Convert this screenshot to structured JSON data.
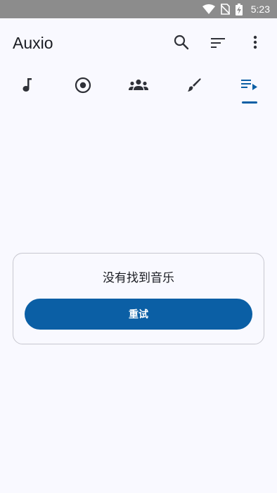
{
  "status_bar": {
    "time": "5:23",
    "icons": [
      "wifi-icon",
      "no-sim-icon",
      "battery-charging-icon"
    ]
  },
  "app_bar": {
    "title": "Auxio",
    "actions": [
      "search-icon",
      "sort-icon",
      "more-vert-icon"
    ]
  },
  "tabs": [
    {
      "icon": "song-icon",
      "selected": false
    },
    {
      "icon": "album-icon",
      "selected": false
    },
    {
      "icon": "artist-icon",
      "selected": false
    },
    {
      "icon": "genre-icon",
      "selected": false
    },
    {
      "icon": "playlist-icon",
      "selected": true
    }
  ],
  "empty_state": {
    "message": "没有找到音乐",
    "retry_label": "重试"
  },
  "colors": {
    "accent": "#0b5fa5",
    "background": "#f9f9ff",
    "status_bar": "#8c8c8c",
    "icon": "#2f3138"
  }
}
